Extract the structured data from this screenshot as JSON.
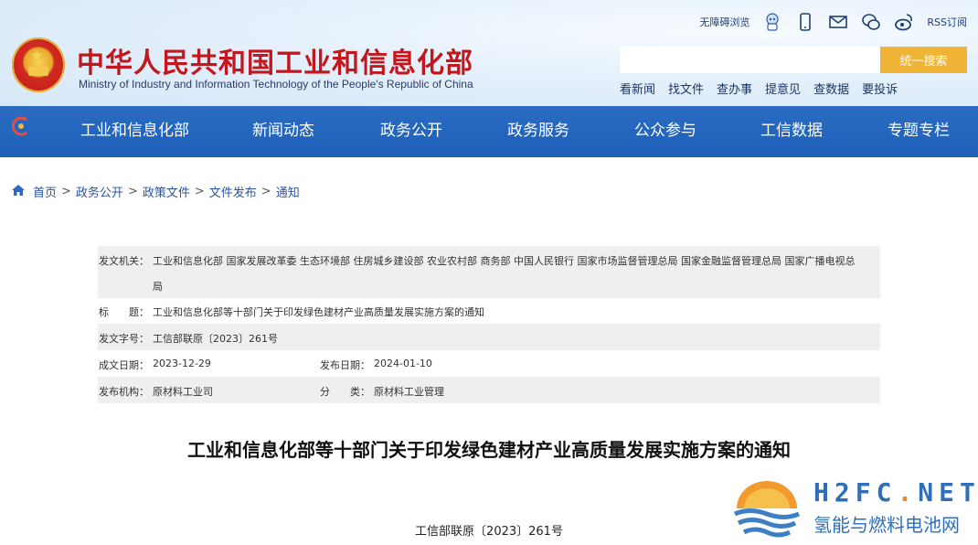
{
  "header": {
    "title": "中华人民共和国工业和信息化部",
    "subtitle": "Ministry of Industry and Information Technology of the People's Republic of China",
    "top_links": {
      "accessible": "无障碍浏览",
      "rss": "RSS订阅"
    },
    "search": {
      "placeholder": "",
      "button": "统一搜索"
    },
    "quick_links": [
      "看新闻",
      "找文件",
      "查办事",
      "提意见",
      "查数据",
      "要投诉"
    ]
  },
  "nav": {
    "items": [
      "工业和信息化部",
      "新闻动态",
      "政务公开",
      "政务服务",
      "公众参与",
      "工信数据",
      "专题专栏"
    ]
  },
  "breadcrumb": [
    "首页",
    "政务公开",
    "政策文件",
    "文件发布",
    "通知"
  ],
  "meta": {
    "issuer_label": "发文机关：",
    "issuer_line1": "工业和信息化部 国家发展改革委 生态环境部 住房城乡建设部 农业农村部 商务部 中国人民银行 国家市场监督管理总局 国家金融监督管理总局 国家广播电视总",
    "issuer_line2": "局",
    "title_label": "标　　题：",
    "title_value": "工业和信息化部等十部门关于印发绿色建材产业高质量发展实施方案的通知",
    "docno_label": "发文字号：",
    "docno_value": "工信部联原〔2023〕261号",
    "created_label": "成文日期：",
    "created_value": "2023-12-29",
    "published_label": "发布日期：",
    "published_value": "2024-01-10",
    "org_label": "发布机构：",
    "org_value": "原材料工业司",
    "category_label": "分　　类：",
    "category_value": "原材料工业管理"
  },
  "document": {
    "title": "工业和信息化部等十部门关于印发绿色建材产业高质量发展实施方案的通知",
    "number": "工信部联原〔2023〕261号"
  },
  "watermark": {
    "brand_a": "H2FC",
    "brand_dot": ".",
    "brand_b": "NET",
    "brand_cn": "氢能与燃料电池网"
  },
  "colors": {
    "title_red": "#c2171d",
    "nav_blue": "#1d5fb9",
    "search_orange": "#f0b436",
    "link_blue": "#2c54a3"
  }
}
